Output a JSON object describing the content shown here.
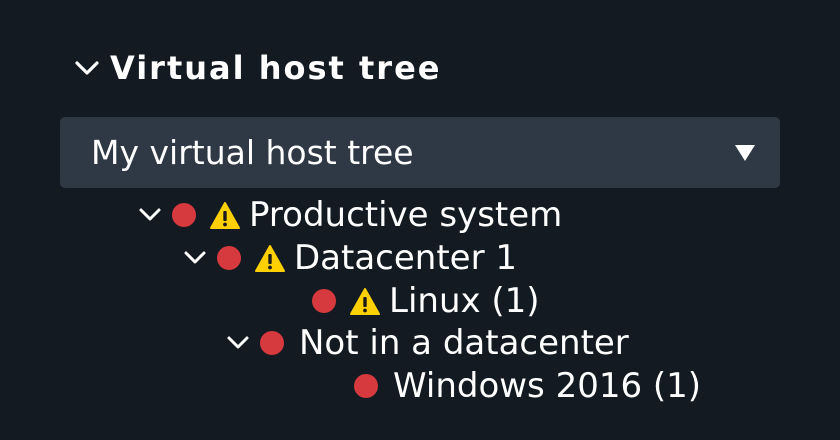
{
  "snapin": {
    "title": "Virtual host tree",
    "collapse_icon": "chevron-down-icon"
  },
  "tree_select": {
    "selected": "My virtual host tree",
    "arrow_icon": "dropdown-triangle-icon"
  },
  "tree": [
    {
      "label": "Productive system",
      "level": 0,
      "expand_icon": "chevron-down-icon",
      "status_color": "#d73a3e",
      "warning_icon": "warning-triangle-icon"
    },
    {
      "label": "Datacenter 1",
      "level": 1,
      "expand_icon": "chevron-down-icon",
      "status_color": "#d73a3e",
      "warning_icon": "warning-triangle-icon"
    },
    {
      "label": "Linux (1)",
      "level": 2,
      "status_color": "#d73a3e",
      "warning_icon": "warning-triangle-icon"
    },
    {
      "label": "Not in a datacenter",
      "level": 1,
      "expand_icon": "chevron-down-icon",
      "status_color": "#d73a3e"
    },
    {
      "label": "Windows 2016 (1)",
      "level": 2,
      "status_color": "#d73a3e"
    }
  ],
  "colors": {
    "background": "#141a21",
    "select_background": "#2f3945",
    "status_critical": "#d73a3e",
    "warning_yellow": "#ffd000"
  }
}
